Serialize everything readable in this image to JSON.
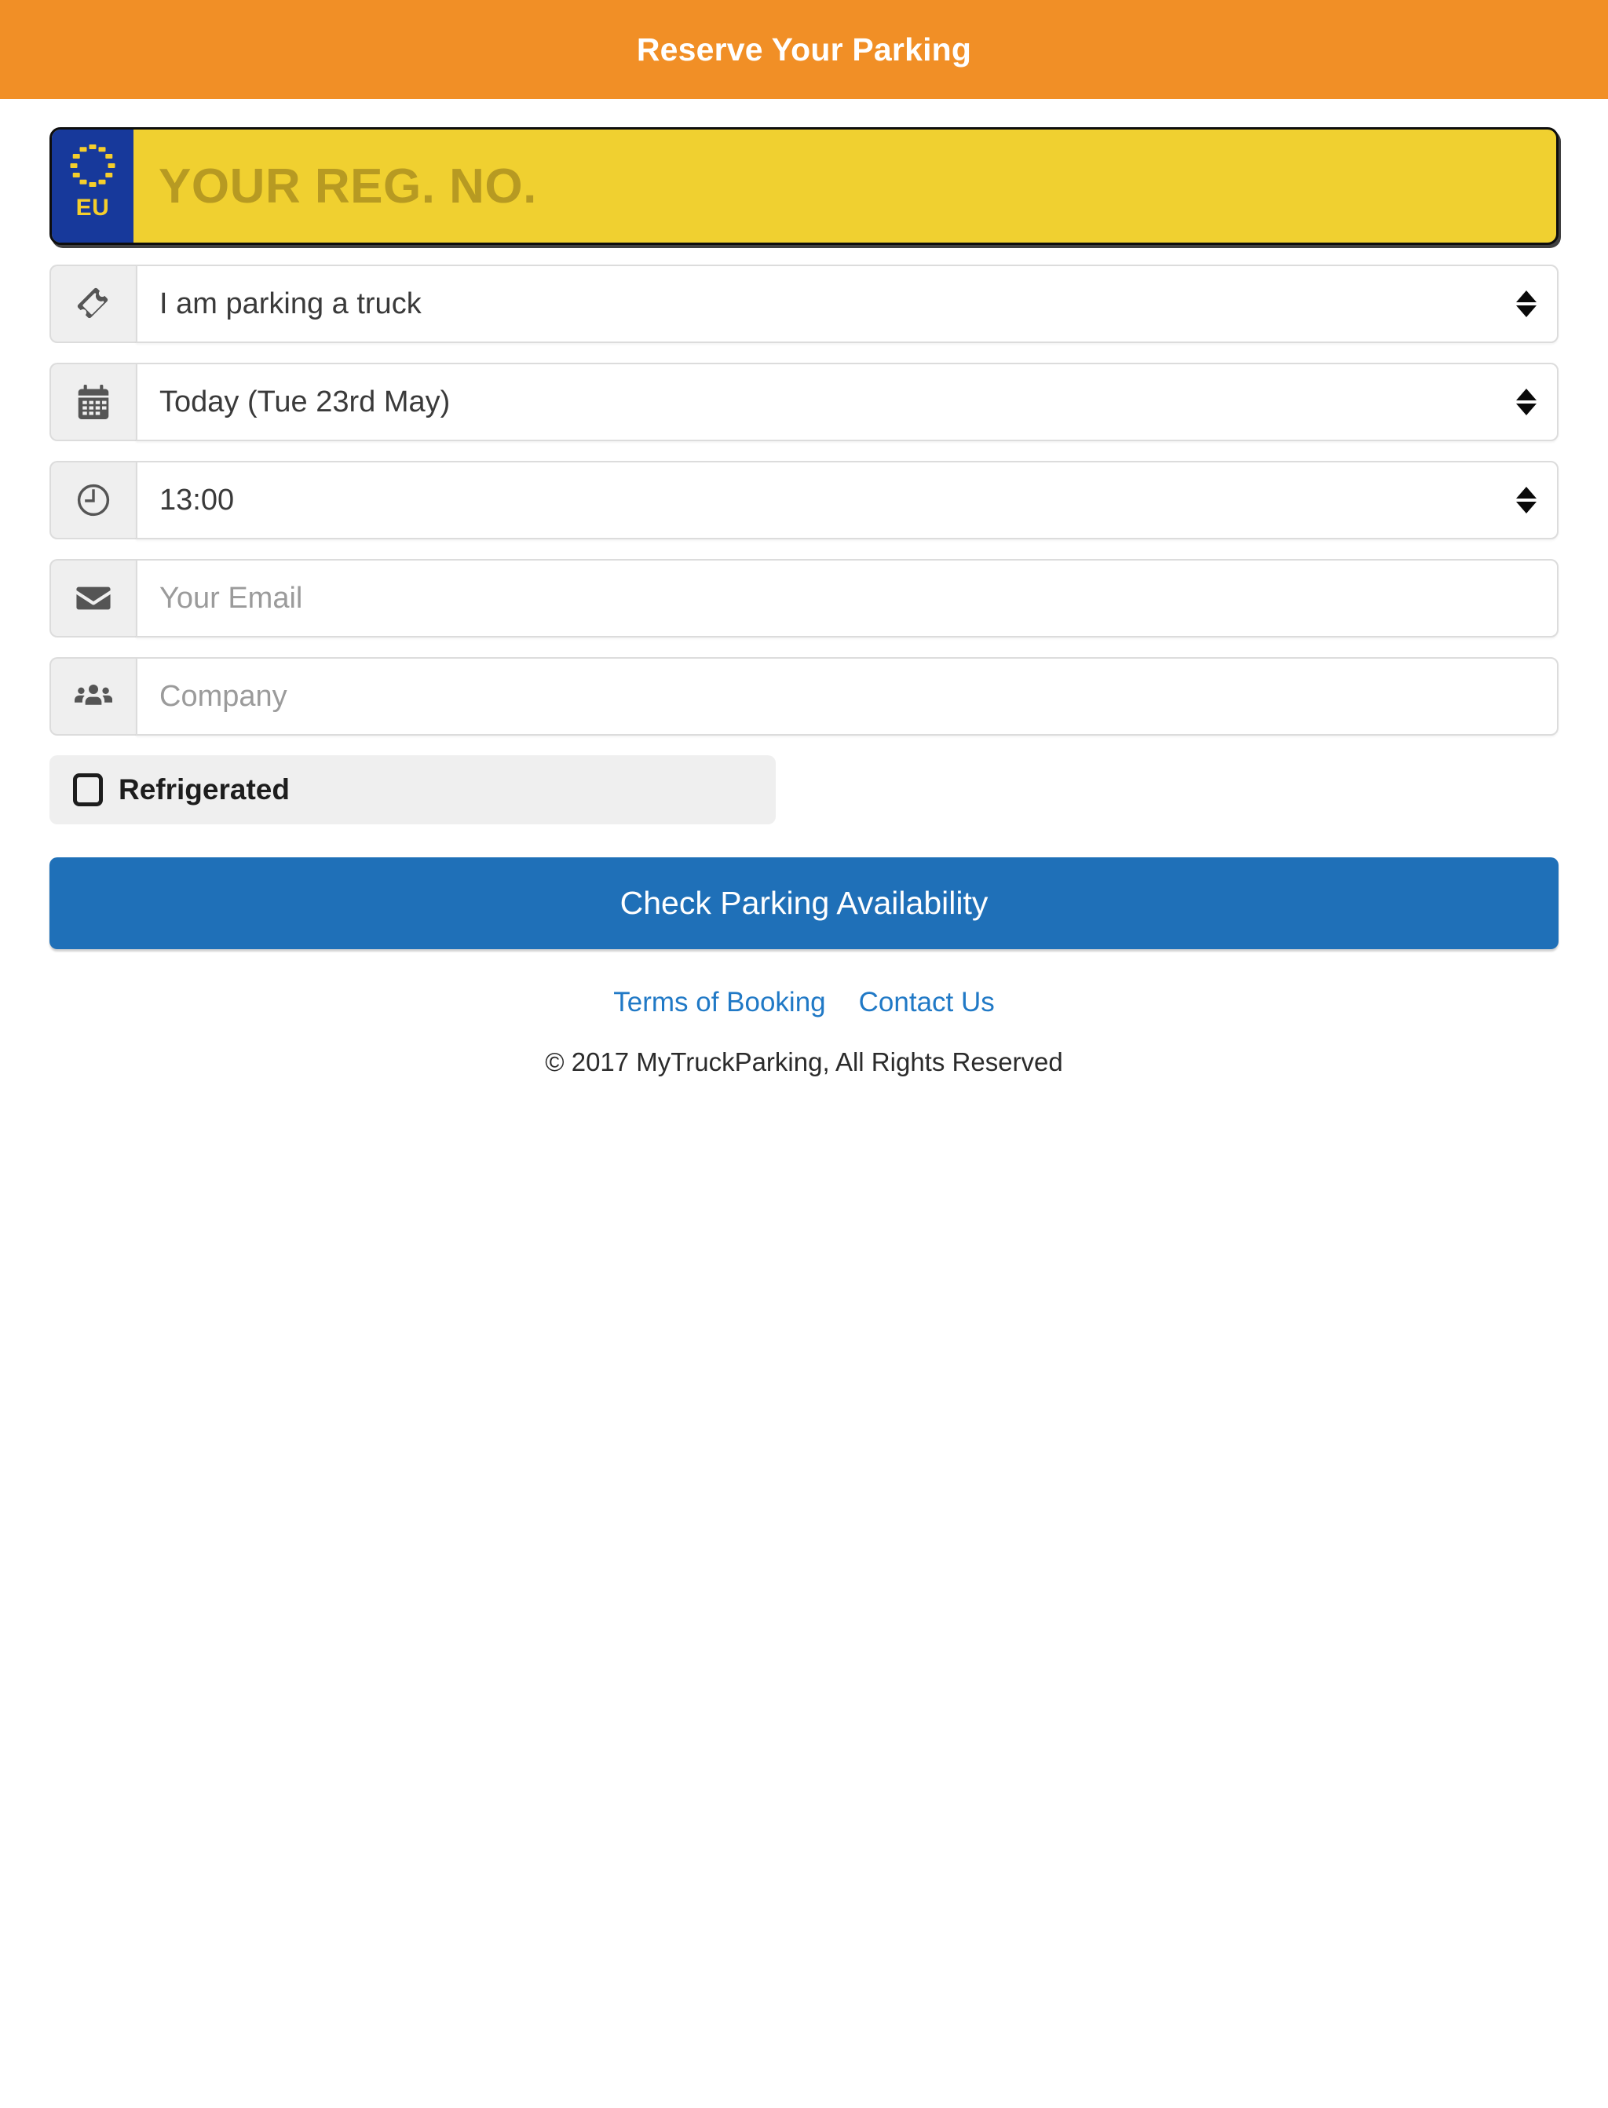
{
  "header": {
    "title": "Reserve Your Parking",
    "background_color": "#F18F26",
    "text_color": "#FFFFFF"
  },
  "plate": {
    "eu_label": "EU",
    "placeholder": "YOUR REG. NO.",
    "value": "",
    "plate_color": "#F0D030",
    "badge_color": "#17399B",
    "badge_text_color": "#F5CE2C",
    "placeholder_color": "#B79A22"
  },
  "fields": [
    {
      "id": "vehicle-type",
      "icon": "ticket-icon",
      "type": "select",
      "value": "I am parking a truck"
    },
    {
      "id": "date",
      "icon": "calendar-icon",
      "type": "select",
      "value": "Today (Tue 23rd May)"
    },
    {
      "id": "time",
      "icon": "clock-icon",
      "type": "select",
      "value": "13:00"
    },
    {
      "id": "email",
      "icon": "envelope-icon",
      "type": "text",
      "value": "",
      "placeholder": "Your Email"
    },
    {
      "id": "company",
      "icon": "users-icon",
      "type": "text",
      "value": "",
      "placeholder": "Company"
    }
  ],
  "refrigerated": {
    "label": "Refrigerated",
    "checked": false
  },
  "submit": {
    "label": "Check Parking Availability",
    "color": "#1F70B8"
  },
  "footer": {
    "links": [
      {
        "label": "Terms of Booking"
      },
      {
        "label": "Contact Us"
      }
    ],
    "copyright": "© 2017 MyTruckParking, All Rights Reserved",
    "link_color": "#2079C6"
  }
}
